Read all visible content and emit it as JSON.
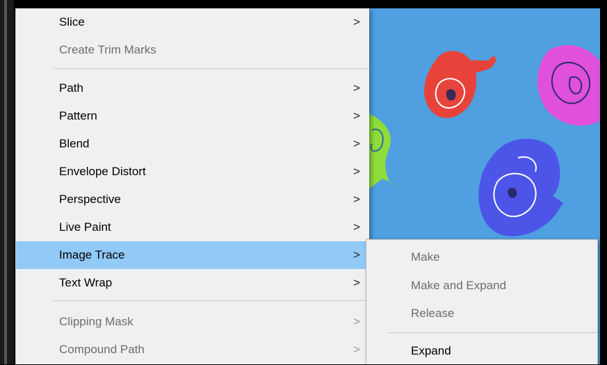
{
  "menu": {
    "items": [
      {
        "label": "Slice",
        "arrow": ">",
        "enabled": true
      },
      {
        "label": "Create Trim Marks",
        "arrow": "",
        "enabled": false
      },
      {
        "label": "Path",
        "arrow": ">",
        "enabled": true
      },
      {
        "label": "Pattern",
        "arrow": ">",
        "enabled": true
      },
      {
        "label": "Blend",
        "arrow": ">",
        "enabled": true
      },
      {
        "label": "Envelope Distort",
        "arrow": ">",
        "enabled": true
      },
      {
        "label": "Perspective",
        "arrow": ">",
        "enabled": true
      },
      {
        "label": "Live Paint",
        "arrow": ">",
        "enabled": true
      },
      {
        "label": "Image Trace",
        "arrow": ">",
        "enabled": true,
        "highlighted": true
      },
      {
        "label": "Text Wrap",
        "arrow": ">",
        "enabled": true
      },
      {
        "label": "Clipping Mask",
        "arrow": ">",
        "enabled": false
      },
      {
        "label": "Compound Path",
        "arrow": ">",
        "enabled": false
      }
    ]
  },
  "submenu": {
    "items": [
      {
        "label": "Make",
        "enabled": false
      },
      {
        "label": "Make and Expand",
        "enabled": false
      },
      {
        "label": "Release",
        "enabled": false
      },
      {
        "label": "Expand",
        "enabled": true
      }
    ]
  },
  "colors": {
    "menu_bg": "#f0f0f0",
    "highlight": "#91c9f7",
    "canvas_bg": "#4f9fe1",
    "pepper_red": "#e8433a",
    "pepper_magenta": "#e050dc",
    "pepper_blue": "#4c55e8",
    "pepper_green": "#8fdc3a"
  }
}
